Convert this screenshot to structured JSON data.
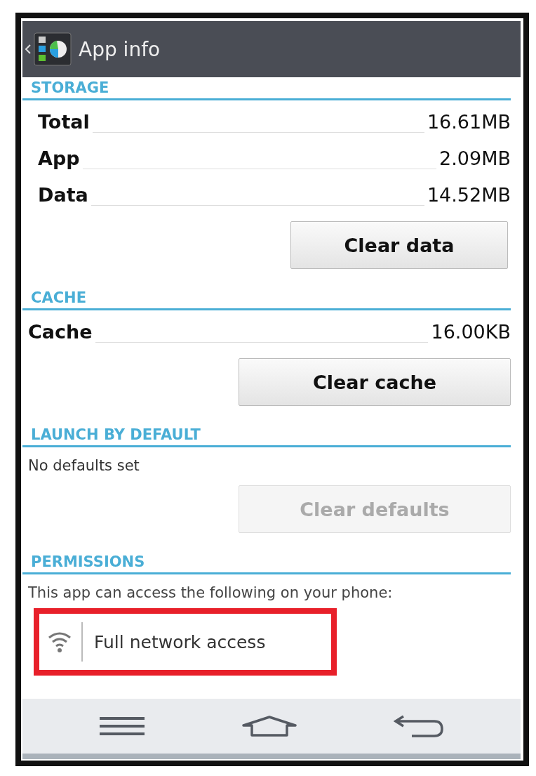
{
  "action_bar": {
    "title": "App info"
  },
  "sections": [
    {
      "heading": "STORAGE",
      "rows": [
        {
          "label": "Total",
          "value": "16.61MB"
        },
        {
          "label": "App",
          "value": "2.09MB"
        },
        {
          "label": "Data",
          "value": "14.52MB"
        }
      ],
      "button": {
        "label": "Clear data",
        "disabled": false
      }
    },
    {
      "heading": "CACHE",
      "rows": [
        {
          "label": "Cache",
          "value": "16.00KB"
        }
      ],
      "button": {
        "label": "Clear cache",
        "disabled": false
      }
    },
    {
      "heading": "LAUNCH BY DEFAULT",
      "note": "No defaults set",
      "button": {
        "label": "Clear defaults",
        "disabled": true
      }
    },
    {
      "heading": "PERMISSIONS",
      "note": "This app can access the following on your phone:",
      "permissions": [
        {
          "label": "Full network access",
          "highlighted": true
        }
      ]
    }
  ]
}
